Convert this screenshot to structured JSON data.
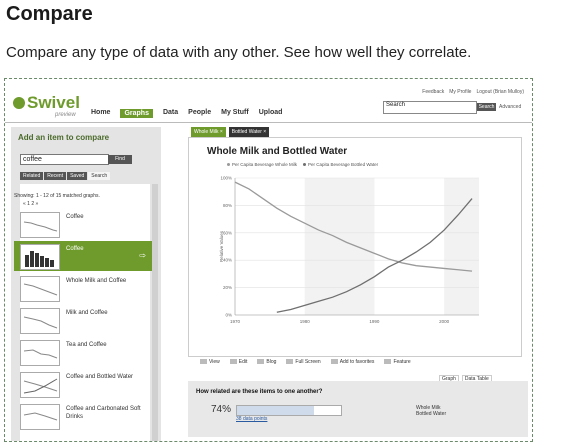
{
  "article": {
    "title": "Compare",
    "description": "Compare any type of data with any other. See how well they correlate."
  },
  "app": {
    "logo": "Swivel",
    "tagline": "preview",
    "nav": [
      "Home",
      "Graphs",
      "Data",
      "People",
      "My Stuff",
      "Upload"
    ],
    "nav_active": "Graphs",
    "user_links": [
      "Feedback",
      "My Profile",
      "Logout (Brian Mulloy)"
    ],
    "search_placeholder": "Search",
    "search_button": "Search",
    "advanced_link": "Advanced"
  },
  "left_panel": {
    "title": "Add an item to compare",
    "query": "coffee",
    "find_button": "Find",
    "tabs": [
      "Related",
      "Recent",
      "Saved",
      "Search"
    ],
    "active_tab": "Search",
    "showing": "Showing: 1 - 12 of 15 matched graphs.",
    "pager": "« 1 2 »",
    "items": [
      {
        "label": "Coffee",
        "selected": false
      },
      {
        "label": "Coffee",
        "selected": true
      },
      {
        "label": "Whole Milk and Coffee",
        "selected": false
      },
      {
        "label": "Milk and Coffee",
        "selected": false
      },
      {
        "label": "Tea and Coffee",
        "selected": false
      },
      {
        "label": "Coffee and Bottled Water",
        "selected": false
      },
      {
        "label": "Coffee and Carbonated Soft Drinks",
        "selected": false
      }
    ]
  },
  "compare_tags": [
    "Whole Milk",
    "Bottled Water"
  ],
  "toolbar": [
    "View",
    "Edit",
    "Blog",
    "Full Screen",
    "Add to favorites",
    "Feature"
  ],
  "subtabs": [
    "Graph",
    "Data Table"
  ],
  "related": {
    "question": "How related are these items to one another?",
    "percent_text": "74%",
    "percent_value": 74,
    "link": "38 data points",
    "legend": [
      "Whole Milk",
      "Bottled Water"
    ]
  },
  "chart_data": {
    "type": "line",
    "title": "Whole Milk and Bottled Water",
    "ylabel": "Relative Values",
    "xlabel": "",
    "xlim": [
      1970,
      2005
    ],
    "ylim": [
      0,
      100
    ],
    "x_ticks": [
      1970,
      1980,
      1990,
      2000
    ],
    "y_ticks": [
      0,
      20,
      40,
      60,
      80,
      100
    ],
    "y_tick_labels": [
      "0%",
      "20%",
      "40%",
      "60%",
      "80%",
      "100%"
    ],
    "colors": {
      "Per Capita Beverage Whole Milk": "#9a9a9a",
      "Per Capita Beverage Bottled Water": "#6f6f6f"
    },
    "series": [
      {
        "name": "Per Capita Beverage Whole Milk",
        "x": [
          1970,
          1972,
          1974,
          1976,
          1978,
          1980,
          1982,
          1984,
          1986,
          1988,
          1990,
          1992,
          1994,
          1996,
          1998,
          2000,
          2002,
          2004
        ],
        "y": [
          97,
          92,
          85,
          78,
          72,
          67,
          62,
          58,
          53,
          49,
          45,
          41,
          38,
          36,
          35,
          34,
          33,
          32
        ]
      },
      {
        "name": "Per Capita Beverage Bottled Water",
        "x": [
          1976,
          1978,
          1980,
          1982,
          1984,
          1986,
          1988,
          1990,
          1992,
          1994,
          1996,
          1998,
          2000,
          2002,
          2004
        ],
        "y": [
          2,
          4,
          7,
          10,
          13,
          17,
          22,
          28,
          35,
          40,
          46,
          53,
          62,
          73,
          85
        ]
      }
    ]
  }
}
